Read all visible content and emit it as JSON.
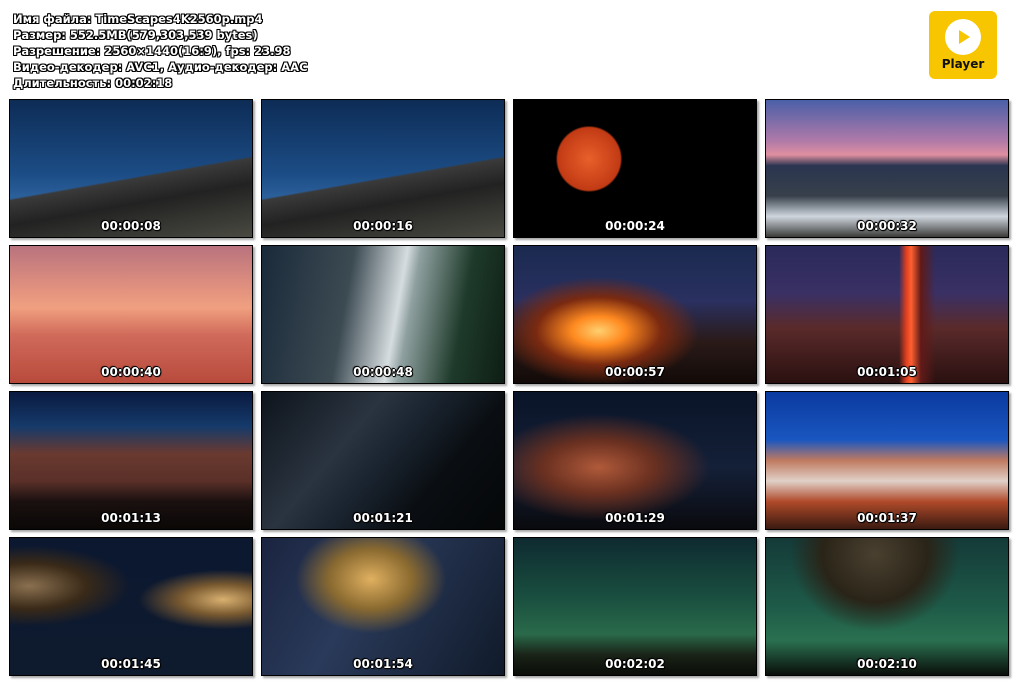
{
  "file_info": {
    "name": "Имя файла: TimeScapes4K2560p.mp4",
    "size": "Размер: 552.5MB(579,303,539 bytes)",
    "resolution": "Разрешение: 2560×1440(16:9), fps: 23.98",
    "codecs": "Видео-декодер: AVC1, Аудио-декодер: AAC",
    "duration": "Длительность: 00:02:18"
  },
  "player": {
    "label": "Player",
    "icon": "play-icon",
    "accent": "#f7c600"
  },
  "thumbnails": [
    {
      "time": "00:00:08",
      "scene": "mountains-blue-sky"
    },
    {
      "time": "00:00:16",
      "scene": "mountains-blue-sky"
    },
    {
      "time": "00:00:24",
      "scene": "blood-moon"
    },
    {
      "time": "00:00:32",
      "scene": "lake-sunset-waterfall"
    },
    {
      "time": "00:00:40",
      "scene": "pink-sunset-sea-bird"
    },
    {
      "time": "00:00:48",
      "scene": "waterfall-moonbow"
    },
    {
      "time": "00:00:57",
      "scene": "campfire-night"
    },
    {
      "time": "00:01:05",
      "scene": "firefall-cliff"
    },
    {
      "time": "00:01:13",
      "scene": "canyon-lake-dusk"
    },
    {
      "time": "00:01:21",
      "scene": "milky-way-forest"
    },
    {
      "time": "00:01:29",
      "scene": "hoodoo-stars"
    },
    {
      "time": "00:01:37",
      "scene": "badlands-blue-sky"
    },
    {
      "time": "00:01:45",
      "scene": "radio-telescopes-night"
    },
    {
      "time": "00:01:54",
      "scene": "radio-telescope-milky-way"
    },
    {
      "time": "00:02:02",
      "scene": "telescope-array-green-sky"
    },
    {
      "time": "00:02:10",
      "scene": "telescope-dish-green-sky"
    }
  ]
}
